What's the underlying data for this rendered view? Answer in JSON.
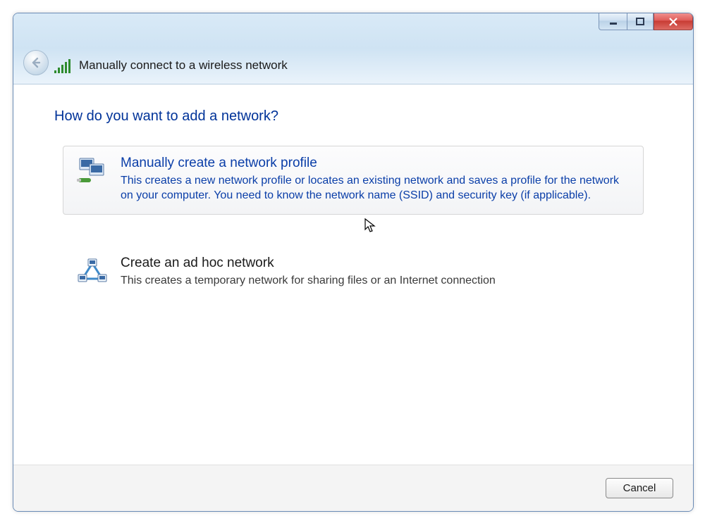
{
  "header": {
    "wizard_title": "Manually connect to a wireless network"
  },
  "main": {
    "heading": "How do you want to add a network?",
    "options": [
      {
        "title": "Manually create a network profile",
        "desc": "This creates a new network profile or locates an existing network and saves a profile for the network on your computer. You need to know the network name (SSID) and security key (if applicable)."
      },
      {
        "title": "Create an ad hoc network",
        "desc": "This creates a temporary network for sharing files or an Internet connection"
      }
    ]
  },
  "footer": {
    "cancel_label": "Cancel"
  }
}
